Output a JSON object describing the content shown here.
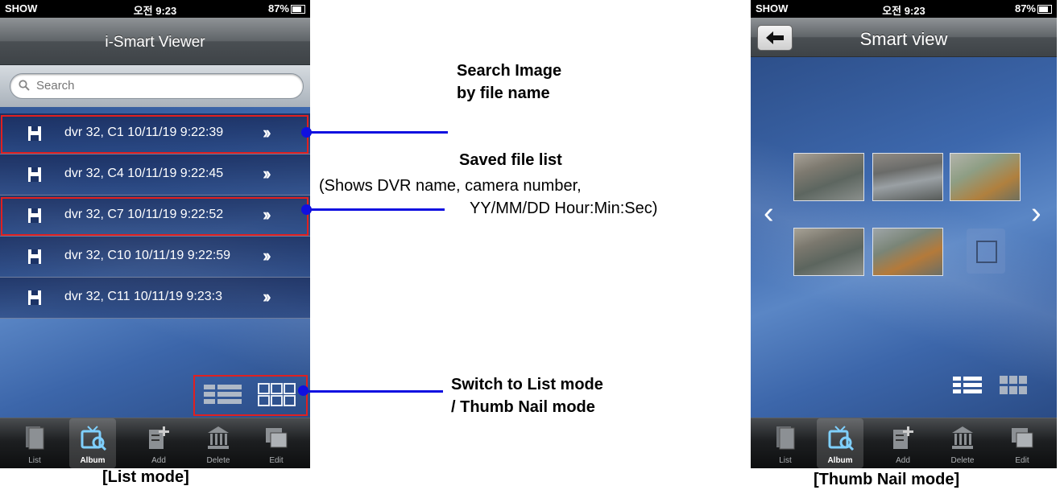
{
  "left_phone": {
    "status": {
      "carrier": "SHOW",
      "time": "오전 9:23",
      "battery": "87%"
    },
    "title": "i-Smart Viewer",
    "search_placeholder": "Search",
    "files": [
      {
        "label": "dvr 32, C1 10/11/19 9:22:39"
      },
      {
        "label": "dvr 32, C4 10/11/19 9:22:45"
      },
      {
        "label": "dvr 32, C7 10/11/19 9:22:52"
      },
      {
        "label": "dvr 32, C10 10/11/19 9:22:59"
      },
      {
        "label": "dvr 32, C11 10/11/19 9:23:3"
      }
    ],
    "toolbar": [
      {
        "label": "List",
        "icon": "list-icon"
      },
      {
        "label": "Album",
        "icon": "album-icon"
      },
      {
        "label": "Add",
        "icon": "add-icon"
      },
      {
        "label": "Delete",
        "icon": "delete-icon"
      },
      {
        "label": "Edit",
        "icon": "edit-icon"
      }
    ],
    "caption": "[List mode]"
  },
  "right_phone": {
    "status": {
      "carrier": "SHOW",
      "time": "오전 9:23",
      "battery": "87%"
    },
    "title": "Smart view",
    "toolbar": [
      {
        "label": "List"
      },
      {
        "label": "Album"
      },
      {
        "label": "Add"
      },
      {
        "label": "Delete"
      },
      {
        "label": "Edit"
      }
    ],
    "caption": "[Thumb Nail mode]"
  },
  "annotations": {
    "search": {
      "line1": "Search  Image",
      "line2": "by file name"
    },
    "saved": {
      "title": "Saved file list",
      "line1": "(Shows DVR name, camera number,",
      "line2": "YY/MM/DD    Hour:Min:Sec)"
    },
    "switch": {
      "line1": "Switch to List mode",
      "line2": "/ Thumb Nail mode"
    }
  },
  "colors": {
    "annotation_line": "#1010e0",
    "highlight_box": "#e02020",
    "accent": "#27457a"
  }
}
